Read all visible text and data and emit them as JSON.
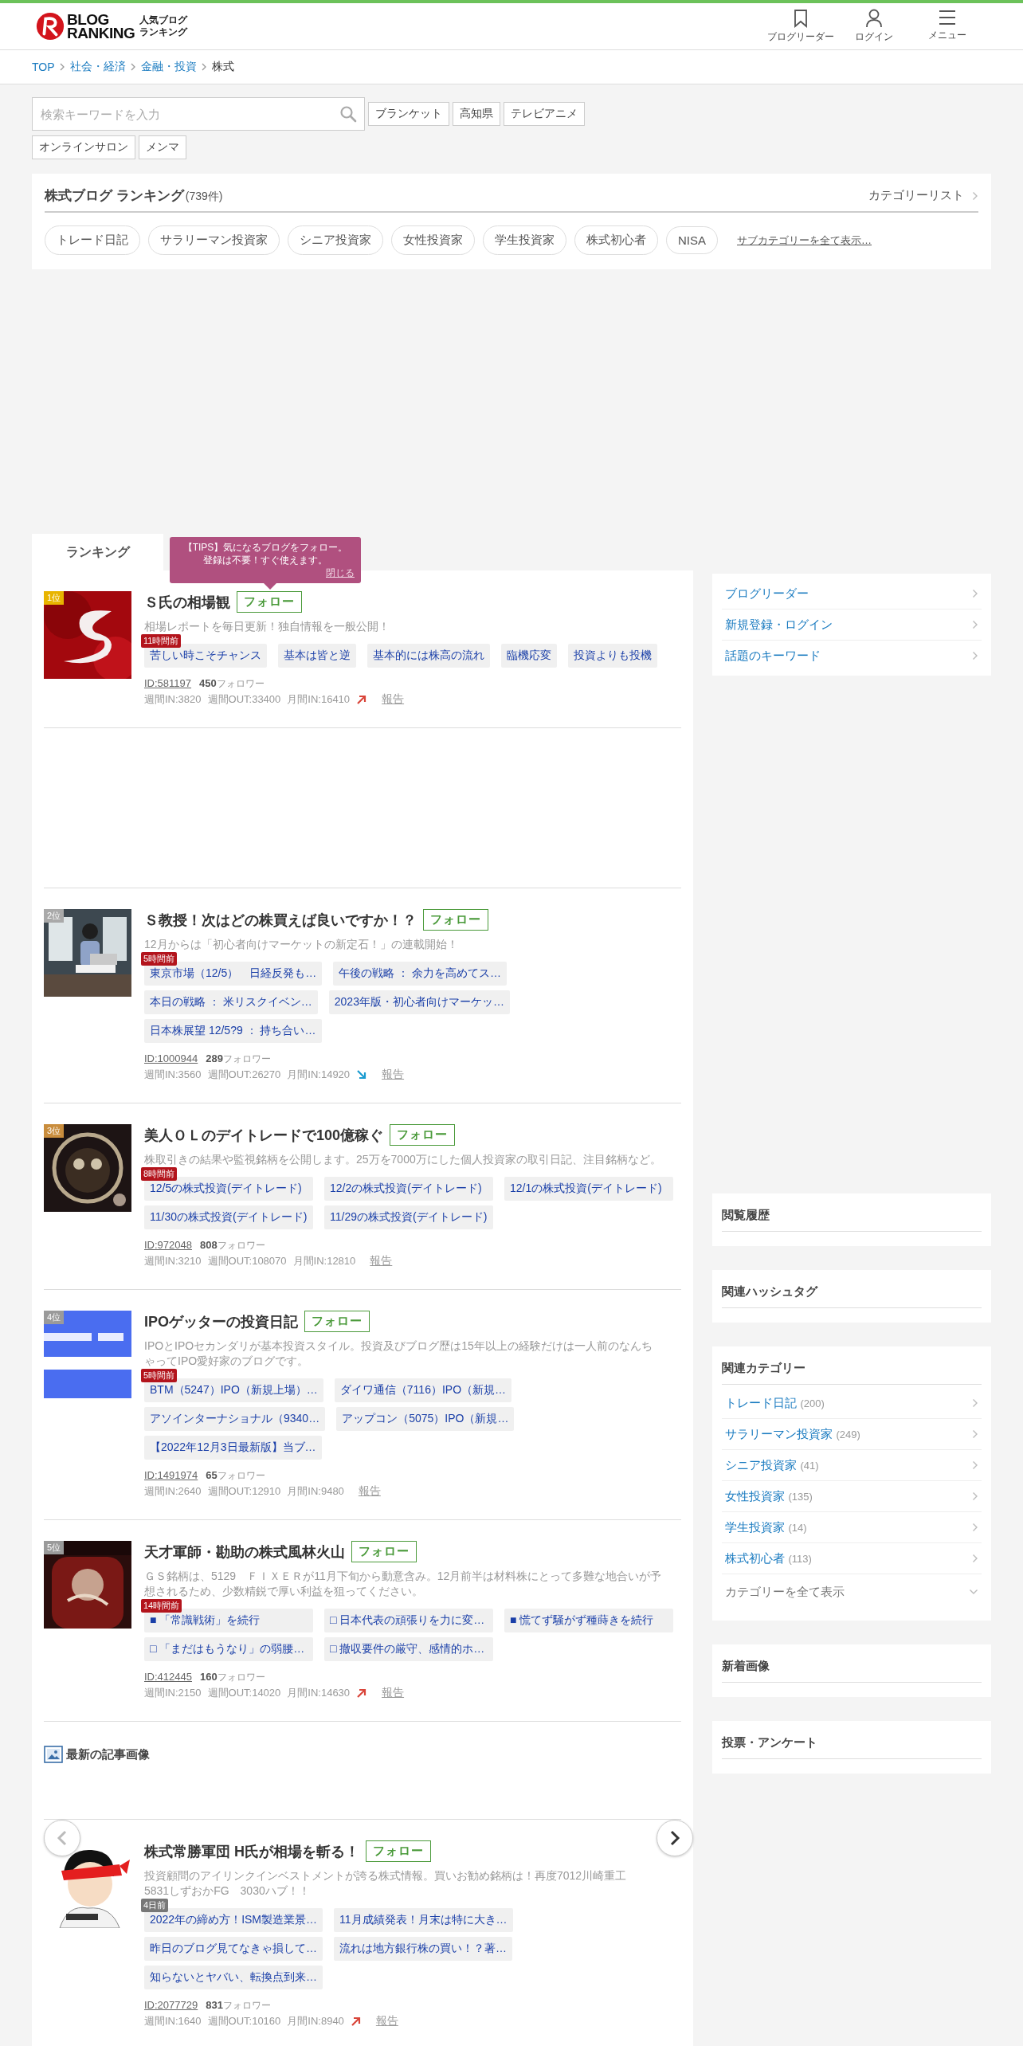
{
  "header": {
    "logo": {
      "line1": "BLOG",
      "line2": "RANKING",
      "tag1": "人気ブログ",
      "tag2": "ランキング"
    },
    "nav": [
      {
        "kind": "bookmark",
        "label": "ブログリーダー"
      },
      {
        "kind": "person",
        "label": "ログイン"
      },
      {
        "kind": "menu",
        "label": "メニュー"
      }
    ]
  },
  "breadcrumb": [
    "TOP",
    "社会・経済",
    "金融・投資",
    "株式"
  ],
  "search": {
    "placeholder": "検索キーワードを入力",
    "keywords": [
      "ブランケット",
      "高知県",
      "テレビアニメ",
      "オンラインサロン",
      "メンマ"
    ]
  },
  "category": {
    "title": "株式ブログ ランキング",
    "count": "(739件)",
    "list_link": "カテゴリーリスト",
    "chips": [
      "トレード日記",
      "サラリーマン投資家",
      "シニア投資家",
      "女性投資家",
      "学生投資家",
      "株式初心者",
      "NISA"
    ],
    "more_link": "サブカテゴリーを全て表示…"
  },
  "tabs": [
    {
      "label": "ランキング",
      "selected": true
    }
  ],
  "tip": {
    "lines": [
      "【TIPS】気になるブログをフォロー。",
      "登録は不要！すぐ使えます。"
    ],
    "close": "閉じる"
  },
  "entries": [
    {
      "rank": "1位",
      "color": "#e8b400",
      "title": "Ｓ氏の相場観",
      "follow": "フォロー",
      "description": "相場レポートを毎日更新！独自情報を一般公開！",
      "age": "11時間前",
      "age_recent": true,
      "article_rows": [
        [
          "苦しい時こそチャンス",
          "基本は皆と逆",
          "基本的には株高の流れ",
          "臨機応変",
          "投資よりも投機"
        ]
      ],
      "id": "ID:581197",
      "followers": "450",
      "followers_label": "フォロワー",
      "stats": [
        "週間IN:3820",
        "週間OUT:33400",
        "月間IN:16410"
      ],
      "rising": true,
      "falling": false,
      "report": "報告"
    },
    {
      "rank": "2位",
      "color": "#a9a9a9",
      "title": "Ｓ教授！次はどの株買えば良いですか！？",
      "follow": "フォロー",
      "description": "12月からは「初心者向けマーケットの新定石！」の連載開始！",
      "age": "5時間前",
      "age_recent": true,
      "article_rows": [
        [
          "東京市場（12/5）　日経反発も…",
          "午後の戦略 ： 余力を高めてス…"
        ],
        [
          "本日の戦略 ： 米リスクイベン…",
          "2023年版・初心者向けマーケッ…"
        ],
        [
          "日本株展望 12/5?9 ： 持ち合い…"
        ]
      ],
      "id": "ID:1000944",
      "followers": "289",
      "followers_label": "フォロワー",
      "stats": [
        "週間IN:3560",
        "週間OUT:26270",
        "月間IN:14920"
      ],
      "rising": false,
      "falling": true,
      "report": "報告"
    },
    {
      "rank": "3位",
      "color": "#c98d3d",
      "title": "美人ＯＬのデイトレードで100億稼ぐ",
      "follow": "フォロー",
      "description": "株取引きの結果や監視銘柄を公開します。25万を7000万にした個人投資家の取引日記、注目銘柄など。",
      "age": "8時間前",
      "age_recent": true,
      "article_rows": [
        [
          "12/5の株式投資(デイトレード)",
          "12/2の株式投資(デイトレード)",
          "12/1の株式投資(デイトレード)"
        ],
        [
          "11/30の株式投資(デイトレード)",
          "11/29の株式投資(デイトレード)"
        ]
      ],
      "id": "ID:972048",
      "followers": "808",
      "followers_label": "フォロワー",
      "stats": [
        "週間IN:3210",
        "週間OUT:108070",
        "月間IN:12810"
      ],
      "rising": false,
      "falling": false,
      "report": "報告"
    },
    {
      "rank": "4位",
      "color": "#9a9a9a",
      "title": "IPOゲッターの投資日記",
      "follow": "フォロー",
      "description": "IPOとIPOセカンダリが基本投資スタイル。投資及びブログ歴は15年以上の経験だけは一人前のなんちゃってIPO愛好家のブログです。",
      "age": "5時間前",
      "age_recent": true,
      "article_rows": [
        [
          "BTM（5247）IPO（新規上場）…",
          "ダイワ通信（7116）IPO（新規…"
        ],
        [
          "アソインターナショナル（9340…",
          "アップコン（5075）IPO（新規…"
        ],
        [
          "【2022年12月3日最新版】当ブ…"
        ]
      ],
      "id": "ID:1491974",
      "followers": "65",
      "followers_label": "フォロワー",
      "stats": [
        "週間IN:2640",
        "週間OUT:12910",
        "月間IN:9480"
      ],
      "rising": false,
      "falling": false,
      "report": "報告"
    },
    {
      "rank": "5位",
      "color": "#9a9a9a",
      "title": "天才軍師・勘助の株式風林火山",
      "follow": "フォロー",
      "description": "ＧＳ銘柄は、5129　ＦＩＸＥＲが11月下旬から動意含み。12月前半は材料株にとって多難な地合いが予想されるため、少数精鋭で厚い利益を狙ってください。",
      "age": "14時間前",
      "age_recent": true,
      "article_rows": [
        [
          "■ 「常識戦術」を続行",
          "□ 日本代表の頑張りを力に変…",
          "■ 慌てず騒がず種蒔きを続行"
        ],
        [
          "□ 「まだはもうなり」の弱腰…",
          "□ 撤収要件の厳守、感情的ホ…"
        ]
      ],
      "id": "ID:412445",
      "followers": "160",
      "followers_label": "フォロワー",
      "stats": [
        "週間IN:2150",
        "週間OUT:14020",
        "月間IN:14630"
      ],
      "rising": true,
      "falling": false,
      "report": "報告"
    }
  ],
  "latest_images": {
    "title": "最新の記事画像"
  },
  "carousel_buttons": [
    {
      "kind": "prev",
      "disabled": true
    },
    {
      "kind": "next",
      "disabled": false
    }
  ],
  "featured": {
    "title": "株式常勝軍団 H氏が相場を斬る！",
    "follow": "フォロー",
    "description": "投資顧問のアイリンクインベストメントが誇る株式情報。買いお勧め銘柄は！再度7012川崎重工　5831しずおかFG　3030ハブ！！",
    "age": "4日前",
    "age_recent": false,
    "article_rows": [
      [
        "2022年の締め方！ISM製造業景…",
        "11月成績発表！月末は特に大き…"
      ],
      [
        "昨日のブログ見てなきゃ損して…",
        "流れは地方銀行株の買い！？著…"
      ],
      [
        "知らないとヤバい、転換点到来…"
      ]
    ],
    "id": "ID:2077729",
    "followers": "831",
    "followers_label": "フォロワー",
    "stats": [
      "週間IN:1640",
      "週間OUT:10160",
      "月間IN:8940"
    ],
    "rising": true,
    "falling": false,
    "report": "報告"
  },
  "sidebar": {
    "links": [
      "ブログリーダー",
      "新規登録・ログイン",
      "話題のキーワード"
    ],
    "history": {
      "title": "閲覧履歴"
    },
    "hashtags": {
      "title": "関連ハッシュタグ"
    },
    "related": {
      "title": "関連カテゴリー",
      "items": [
        {
          "name": "トレード日記",
          "count": "(200)"
        },
        {
          "name": "サラリーマン投資家",
          "count": "(249)"
        },
        {
          "name": "シニア投資家",
          "count": "(41)"
        },
        {
          "name": "女性投資家",
          "count": "(135)"
        },
        {
          "name": "学生投資家",
          "count": "(14)"
        },
        {
          "name": "株式初心者",
          "count": "(113)"
        }
      ],
      "show_all": "カテゴリーを全て表示"
    },
    "new_images": {
      "title": "新着画像"
    },
    "polls": {
      "title": "投票・アンケート"
    }
  }
}
